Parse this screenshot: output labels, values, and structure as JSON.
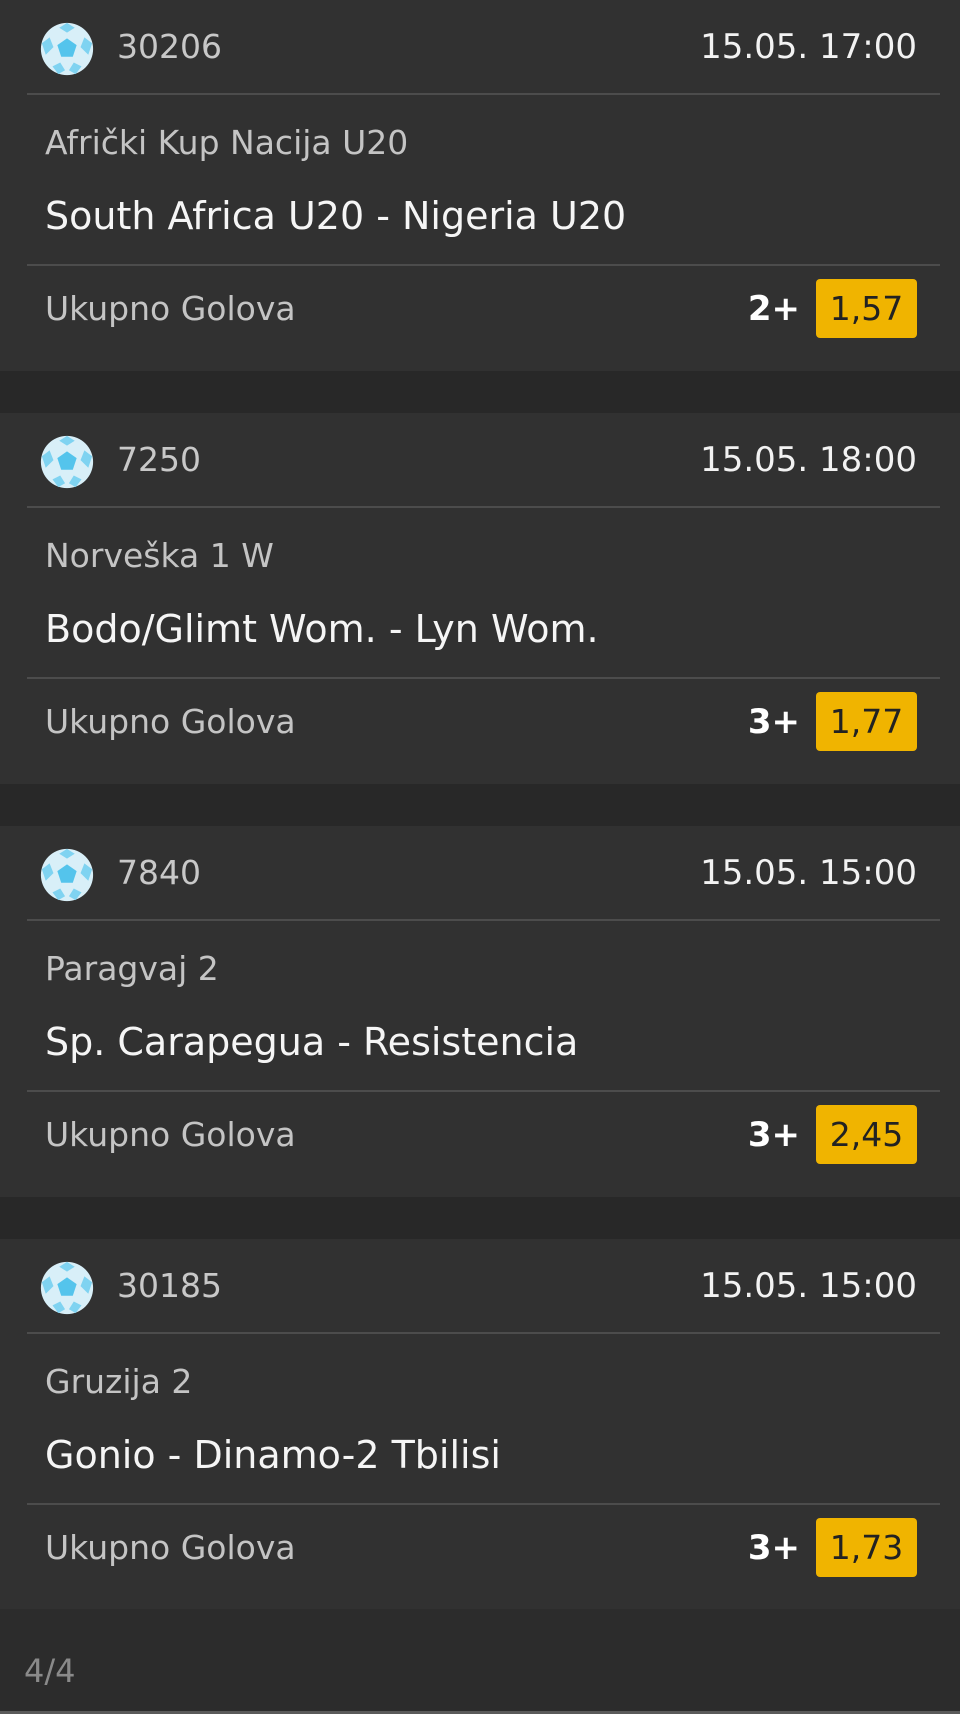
{
  "tickets": [
    {
      "id": "30206",
      "datetime": "15.05. 17:00",
      "league": "Afrički Kup Nacija U20",
      "teams": "South Africa U20 - Nigeria U20",
      "market": "Ukupno Golova",
      "pick": "2+",
      "odds": "1,57",
      "sport_icon": "soccer-ball-icon"
    },
    {
      "id": "7250",
      "datetime": "15.05. 18:00",
      "league": "Norveška 1 W",
      "teams": "Bodo/Glimt Wom. - Lyn Wom.",
      "market": "Ukupno Golova",
      "pick": "3+",
      "odds": "1,77",
      "sport_icon": "soccer-ball-icon"
    },
    {
      "id": "7840",
      "datetime": "15.05. 15:00",
      "league": "Paragvaj 2",
      "teams": "Sp. Carapegua - Resistencia",
      "market": "Ukupno Golova",
      "pick": "3+",
      "odds": "2,45",
      "sport_icon": "soccer-ball-icon"
    },
    {
      "id": "30185",
      "datetime": "15.05. 15:00",
      "league": "Gruzija 2",
      "teams": "Gonio - Dinamo-2 Tbilisi",
      "market": "Ukupno Golova",
      "pick": "3+",
      "odds": "1,73",
      "sport_icon": "soccer-ball-icon"
    }
  ],
  "footer": {
    "pager": "4/4"
  },
  "colors": {
    "background": "#282828",
    "card": "#313131",
    "odds_badge": "#f0b400",
    "ball_primary": "#cfeaf6",
    "ball_secondary": "#58c7ee"
  }
}
